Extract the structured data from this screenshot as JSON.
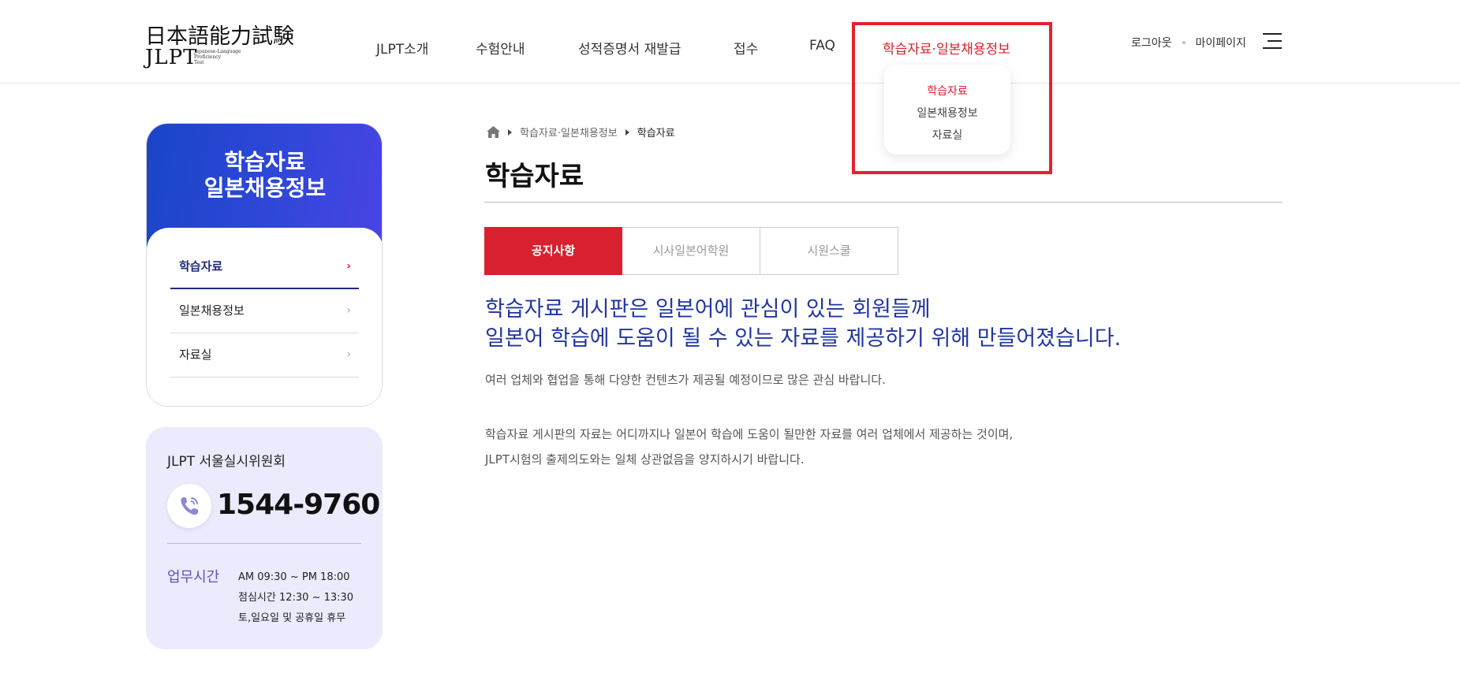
{
  "header": {
    "logo": {
      "kanji": "日本語能力試験",
      "jlpt": "JLPT",
      "sub": [
        "Japanese-Language",
        "Proficiency",
        "Test"
      ]
    },
    "nav": [
      "JLPT소개",
      "수험안내",
      "성적증명서 재발급",
      "접수",
      "FAQ",
      "학습자료·일본채용정보"
    ],
    "util": {
      "logout": "로그아웃",
      "mypage": "마이페이지"
    }
  },
  "dropdown": {
    "items": [
      "학습자료",
      "일본채용정보",
      "자료실"
    ],
    "active_index": 0
  },
  "sidebar": {
    "title_line1": "학습자료",
    "title_line2": "일본채용정보",
    "items": [
      {
        "label": "학습자료",
        "arrow": "›"
      },
      {
        "label": "일본채용정보",
        "arrow": "›"
      },
      {
        "label": "자료실",
        "arrow": "›"
      }
    ]
  },
  "contact": {
    "title": "JLPT 서울실시위원회",
    "phone": "1544-9760",
    "hours_label": "업무시간",
    "hours": [
      "AM 09:30 ~ PM 18:00",
      "점심시간 12:30 ~ 13:30",
      "토,일요일 및 공휴일 휴무"
    ]
  },
  "breadcrumb": {
    "parent": "학습자료·일본채용정보",
    "current": "학습자료"
  },
  "page_title": "학습자료",
  "tabs": [
    "공지사항",
    "시사일본어학원",
    "시원스쿨"
  ],
  "lead": {
    "line1": "학습자료 게시판은 일본어에 관심이 있는 회원들께",
    "line2": "일본어 학습에 도움이 될 수 있는 자료를 제공하기 위해 만들어졌습니다."
  },
  "para1": "여러 업체와 협업을 통해 다양한 컨텐츠가 제공될 예정이므로 많은 관심 바랍니다.",
  "para2": {
    "line1": "학습자료 게시판의 자료는 어디까지나 일본어 학습에 도움이 될만한 자료를 여러 업체에서 제공하는 것이며,",
    "line2": "JLPT시험의 출제의도와는 일체 상관없음을 양지하시기 바랍니다."
  },
  "colors": {
    "accent_red": "#d9202f",
    "brand_blue": "#2236a0",
    "highlight": "#e3222e"
  },
  "icons": [
    "hamburger-icon",
    "home-icon",
    "phone-icon",
    "chevron-right-icon"
  ]
}
